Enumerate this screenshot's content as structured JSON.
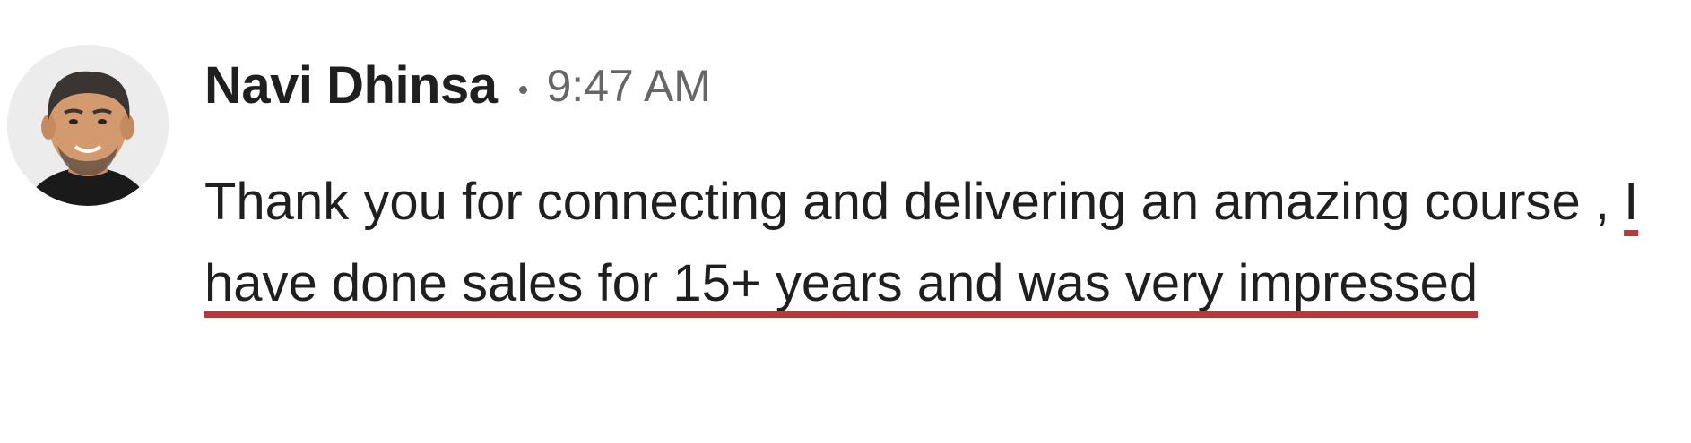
{
  "message": {
    "sender": "Navi Dhinsa",
    "separator": "•",
    "time": "9:47 AM",
    "text_plain": "Thank you for connecting and delivering an amazing course , ",
    "text_highlighted": "I have done sales for 15+ years and was very impressed",
    "avatar_icon": "profile-photo-avatar"
  },
  "colors": {
    "underline": "#b53a3a",
    "time": "#666666",
    "text": "#1f1f1f"
  }
}
